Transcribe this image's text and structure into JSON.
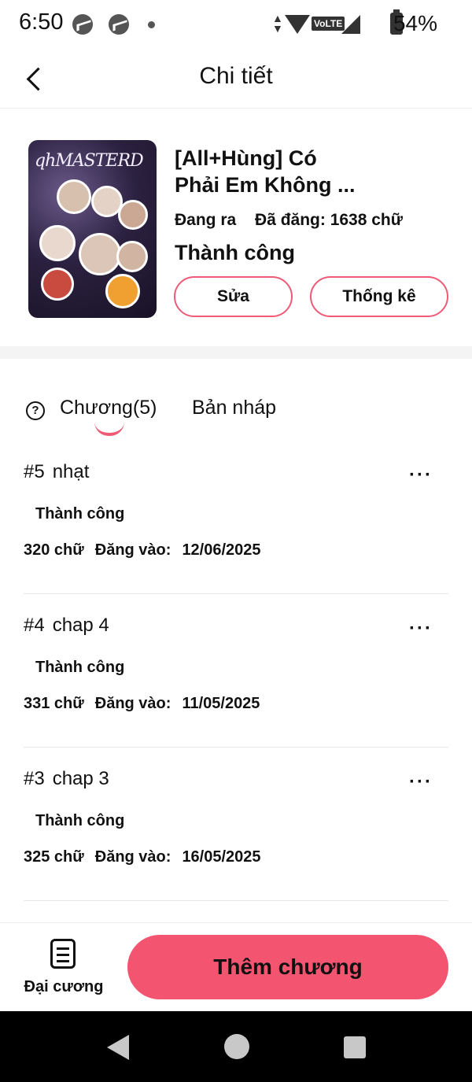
{
  "status_bar": {
    "time": "6:50",
    "network": "VoLTE",
    "battery": "54%"
  },
  "header": {
    "title": "Chi tiết"
  },
  "book": {
    "cover_text": "qhMASTERD",
    "title_line1": "[All+Hùng] Có",
    "title_line2": "Phải Em Không ...",
    "state": "Đang ra",
    "published": "Đã đăng: 1638 chữ",
    "status": "Thành công",
    "edit_label": "Sửa",
    "stats_label": "Thống kê"
  },
  "tabs": {
    "chapters": "Chương(5)",
    "drafts": "Bản nháp",
    "help": "?"
  },
  "chapters": [
    {
      "num": "#5",
      "name": "nhạt",
      "status": "Thành công",
      "words": "320 chữ",
      "date_label": "Đăng vào:",
      "date": "12/06/2025",
      "more": "···"
    },
    {
      "num": "#4",
      "name": "chap 4",
      "status": "Thành công",
      "words": "331 chữ",
      "date_label": "Đăng vào:",
      "date": "11/05/2025",
      "more": "···"
    },
    {
      "num": "#3",
      "name": "chap 3",
      "status": "Thành công",
      "words": "325 chữ",
      "date_label": "Đăng vào:",
      "date": "16/05/2025",
      "more": "···"
    }
  ],
  "bottom": {
    "outline_label": "Đại cương",
    "add_chapter_label": "Thêm chương"
  },
  "colors": {
    "accent": "#f35470",
    "outline_accent": "#ef5a76"
  }
}
